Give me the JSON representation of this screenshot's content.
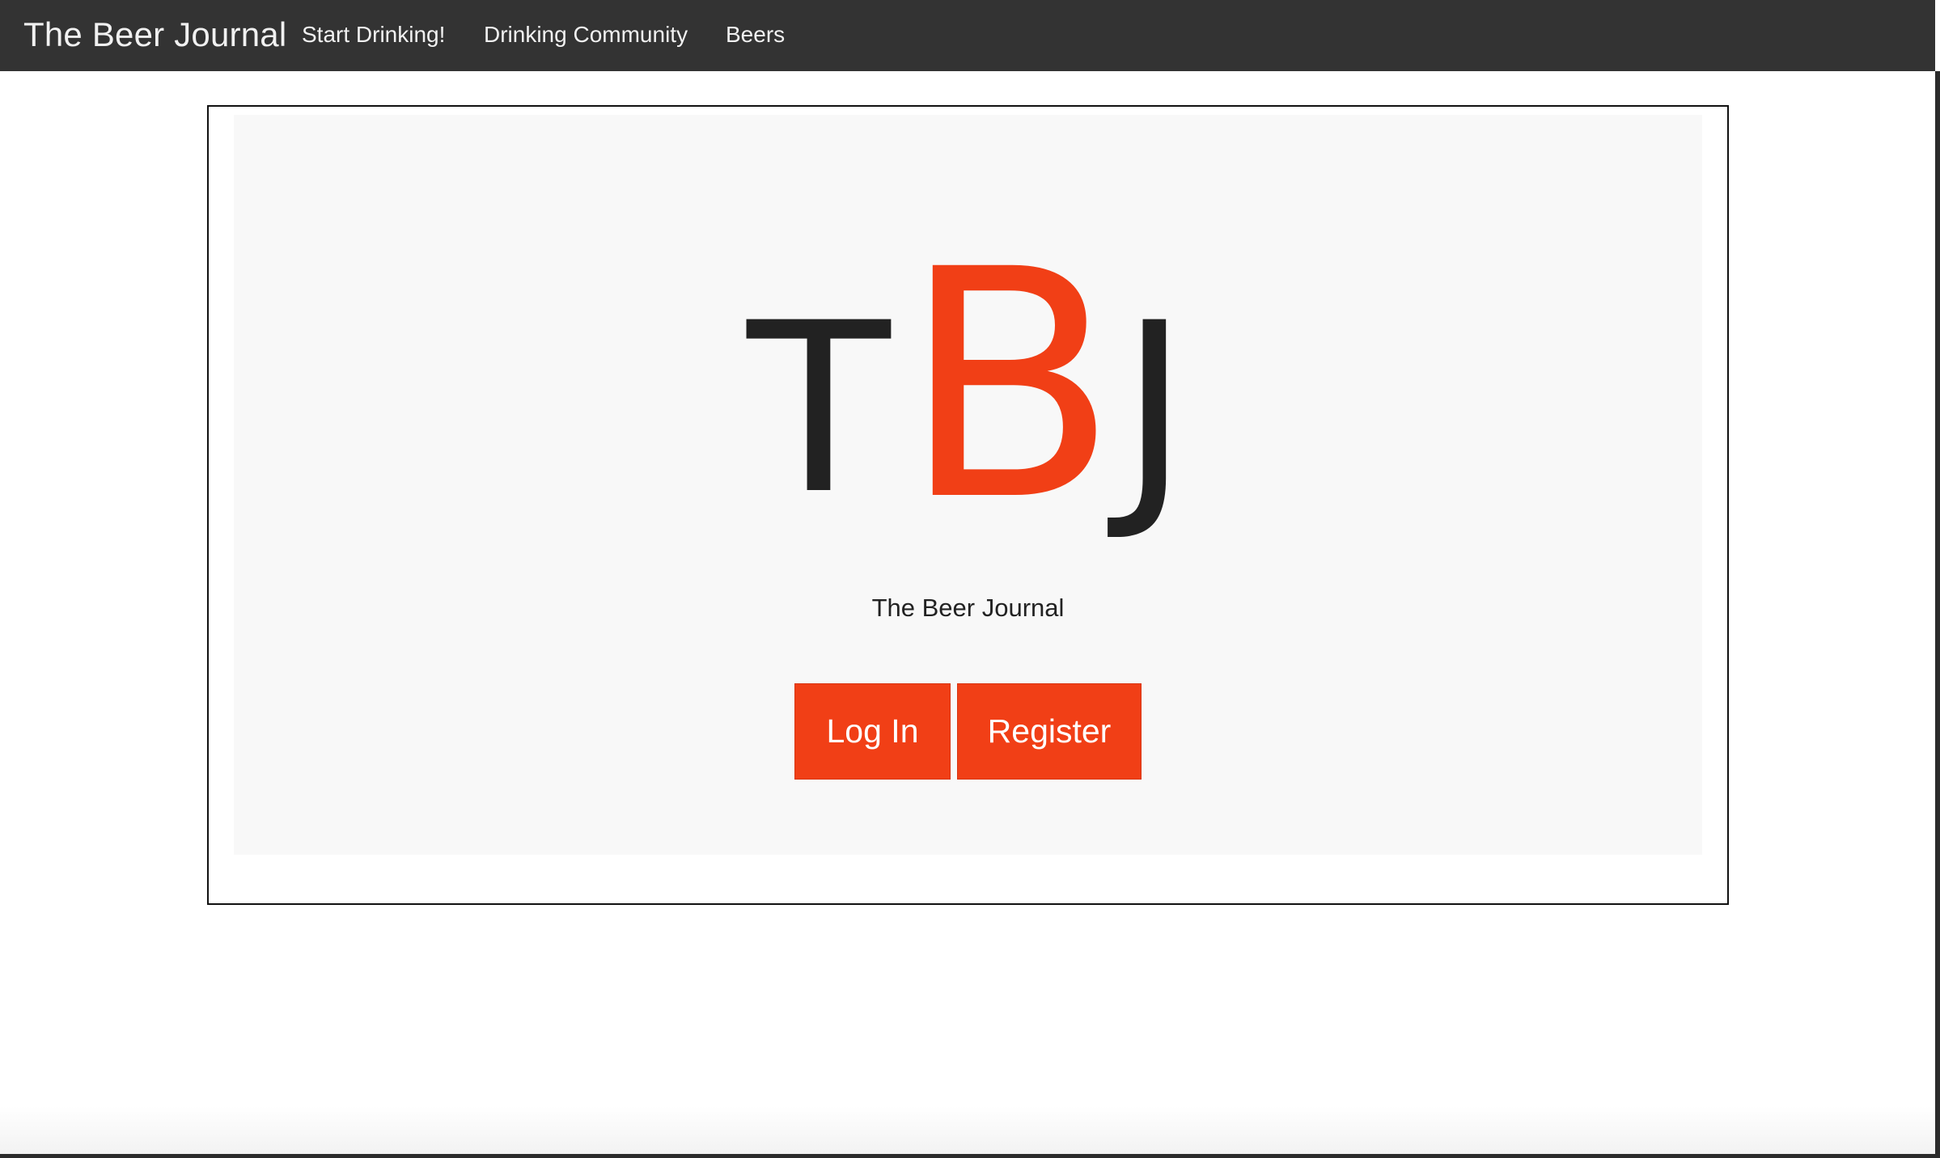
{
  "navbar": {
    "brand": "The Beer Journal",
    "links": [
      {
        "label": "Start Drinking!"
      },
      {
        "label": "Drinking Community"
      },
      {
        "label": "Beers"
      }
    ]
  },
  "hero": {
    "logo": {
      "t": "T",
      "b": "B",
      "j": "J"
    },
    "tagline": "The Beer Journal",
    "login_label": "Log In",
    "register_label": "Register"
  },
  "colors": {
    "navbar_background": "#333333",
    "accent": "#f13f16",
    "logo_dark": "#222222",
    "hero_background": "#f8f8f8"
  }
}
